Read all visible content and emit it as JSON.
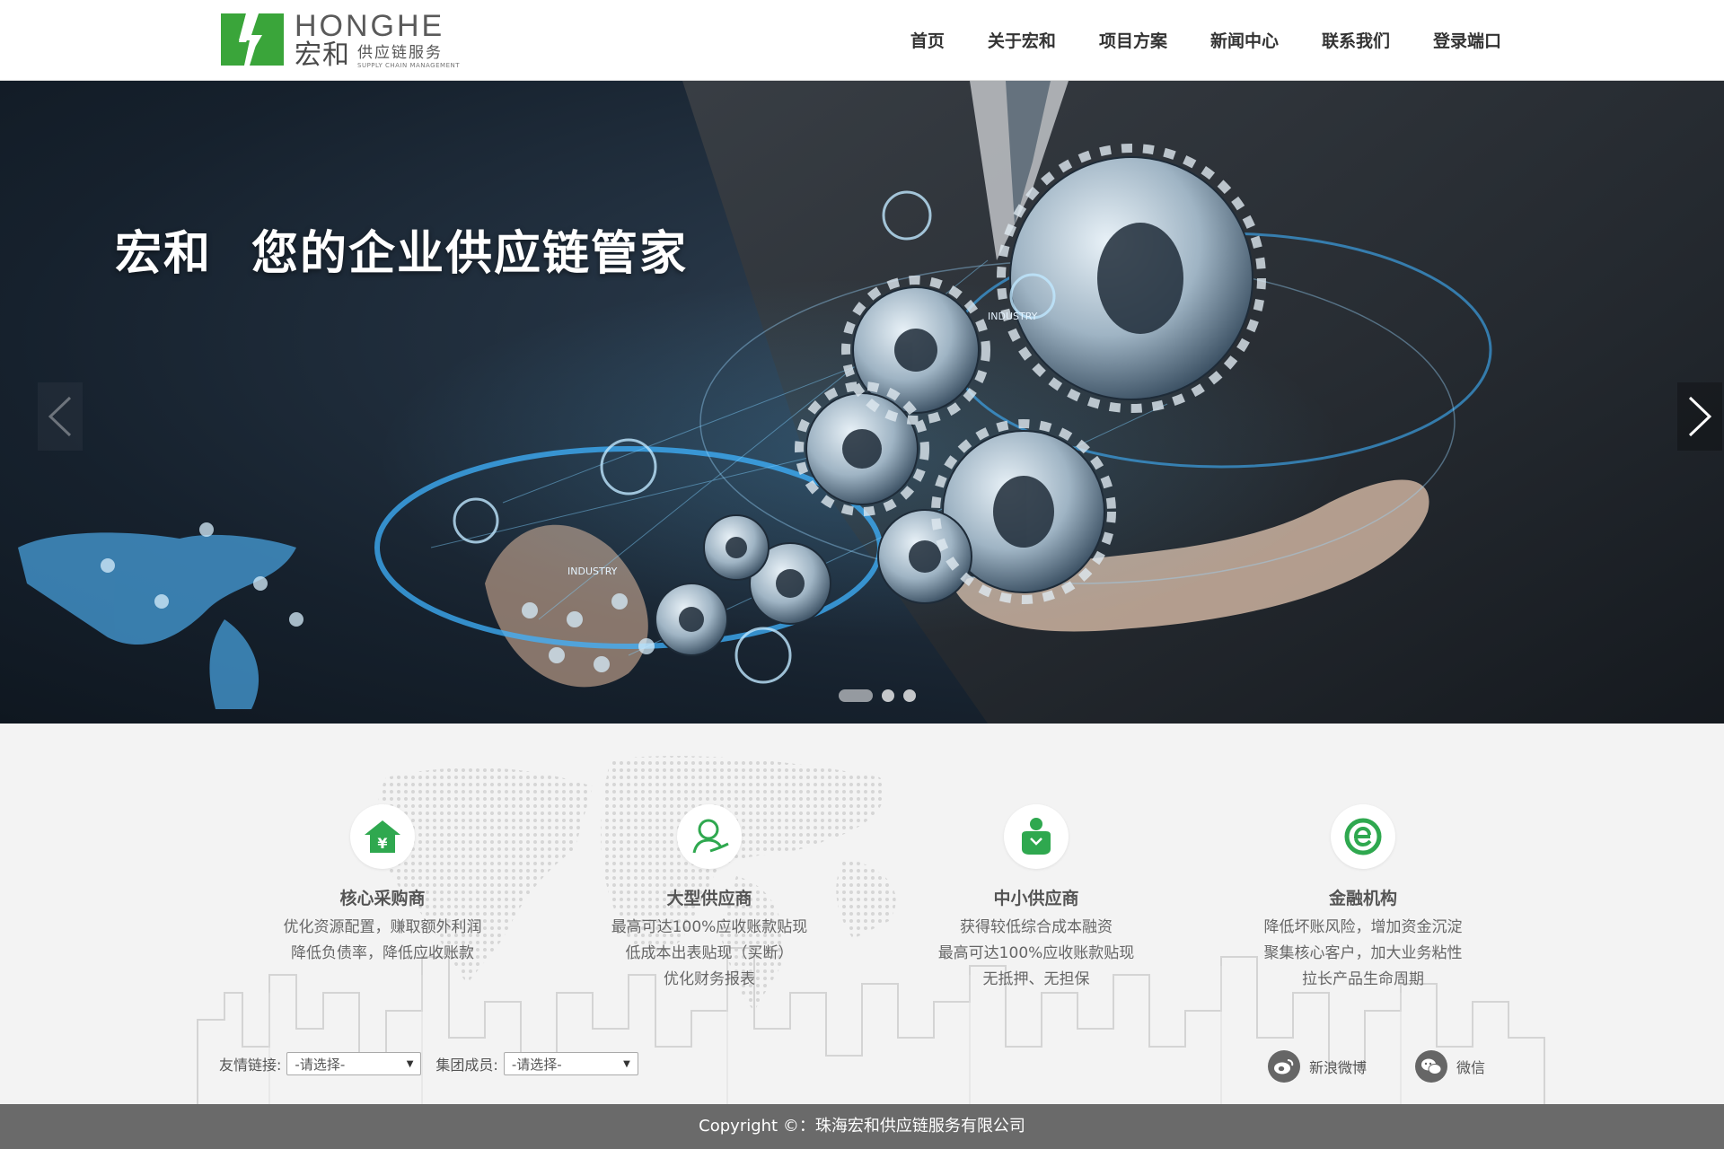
{
  "header": {
    "logo_en": "HONGHE",
    "logo_cn": "宏和",
    "logo_sub_cn": "供应链服务",
    "logo_sub_en": "SUPPLY CHAIN MANAGEMENT",
    "brand_color": "#3aa53a",
    "nav": [
      {
        "label": "首页"
      },
      {
        "label": "关于宏和"
      },
      {
        "label": "项目方案"
      },
      {
        "label": "新闻中心"
      },
      {
        "label": "联系我们"
      },
      {
        "label": "登录端口"
      }
    ]
  },
  "hero": {
    "title_part1": "宏和",
    "title_part2": "您的企业供应链管家",
    "labels": [
      "INDUSTRY",
      "INDUSTRY"
    ],
    "slides": 3,
    "active_slide": 1
  },
  "features": [
    {
      "icon": "house-yen-icon",
      "title": "核心采购商",
      "lines": [
        "优化资源配置，赚取额外利润",
        "降低负债率，降低应收账款"
      ]
    },
    {
      "icon": "person-hand-icon",
      "title": "大型供应商",
      "lines": [
        "最高可达100%应收账款贴现",
        "低成本出表贴现（买断）",
        "优化财务报表"
      ]
    },
    {
      "icon": "person-bag-icon",
      "title": "中小供应商",
      "lines": [
        "获得较低综合成本融资",
        "最高可达100%应收账款贴现",
        "无抵押、无担保"
      ]
    },
    {
      "icon": "finance-e-icon",
      "title": "金融机构",
      "lines": [
        "降低坏账风险，增加资金沉淀",
        "聚集核心客户，加大业务粘性",
        "拉长产品生命周期"
      ]
    }
  ],
  "footer": {
    "friend_links_label": "友情链接:",
    "friend_links_value": "-请选择-",
    "group_members_label": "集团成员:",
    "group_members_value": "-请选择-",
    "weibo_label": "新浪微博",
    "wechat_label": "微信",
    "copyright": "Copyright ©：珠海宏和供应链服务有限公司"
  }
}
